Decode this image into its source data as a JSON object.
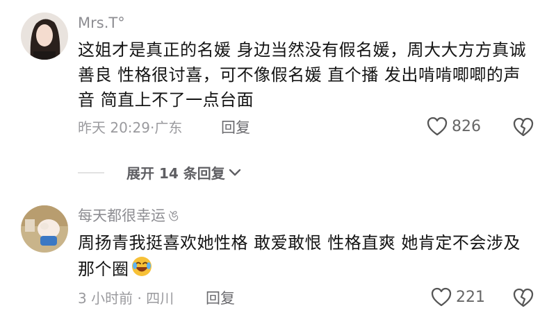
{
  "comments": [
    {
      "username": "Mrs.T°",
      "content": "这姐才是真正的名媛 身边当然没有假名媛，周大大方方真诚善良 性格很讨喜，可不像假名媛 直个播 发出啃啃唧唧的声音 简直上不了一点台面",
      "meta": "昨天 20:29·广东",
      "reply_label": "回复",
      "likes": "826",
      "expand_label": "展开 14 条回复"
    },
    {
      "username": "每天都很幸运",
      "username_suffix": "ঙ",
      "content": "周扬青我挺喜欢她性格 敢爱敢恨 性格直爽 她肯定不会涉及那个圈",
      "meta": "3 小时前 · 四川",
      "reply_label": "回复",
      "likes": "221"
    }
  ],
  "icons": {
    "like": "heart-outline-icon",
    "dislike": "broken-heart-icon",
    "expand": "chevron-down-icon",
    "emoji": "laughing-emoji-icon"
  },
  "colors": {
    "text_primary": "#141414",
    "text_secondary": "#9a9a9e",
    "username": "#8d8d92"
  }
}
